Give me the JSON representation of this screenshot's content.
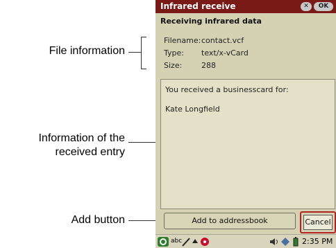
{
  "callouts": {
    "file_information": "File information",
    "entry_line1": "Information of the",
    "entry_line2": "received entry",
    "add_button": "Add button"
  },
  "window": {
    "title": "Infrared receive",
    "close_label": "✕",
    "ok_label": "OK",
    "heading": "Receiving infrared data"
  },
  "file_info": {
    "filename_label": "Filename:",
    "filename_value": "contact.vcf",
    "type_label": "Type:",
    "type_value": "text/x-vCard",
    "size_label": "Size:",
    "size_value": "288"
  },
  "entry": {
    "message": "You received a businesscard for:",
    "name": "Kate Longfield"
  },
  "buttons": {
    "add_label": "Add to addressbook",
    "cancel_label": "Cancel"
  },
  "taskbar": {
    "input_mode": "abc",
    "time": "2:35 PM"
  },
  "colors": {
    "titlebar": "#7a1a16",
    "background": "#d5d2b4",
    "cancel_highlight": "#b22222"
  }
}
